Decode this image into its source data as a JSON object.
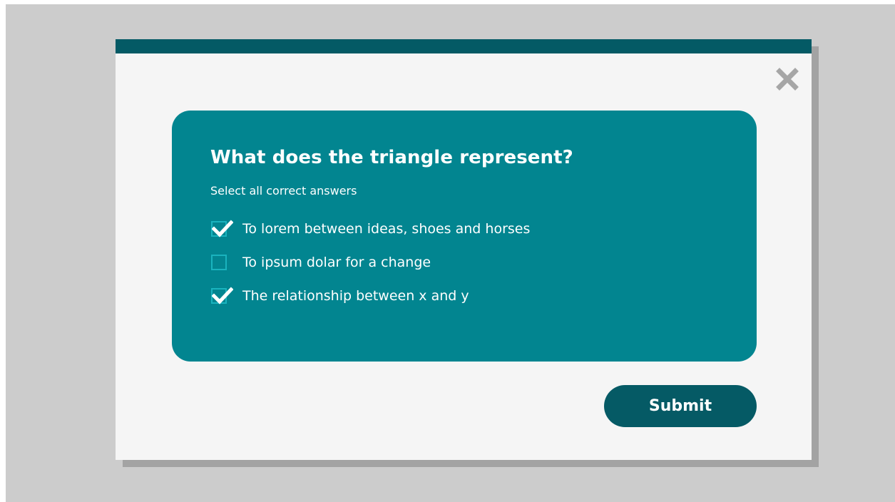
{
  "dialog": {
    "close_icon": "close-icon",
    "question": {
      "title": "What does the triangle represent?",
      "instruction": "Select all correct answers",
      "options": [
        {
          "label": "To lorem between ideas, shoes and horses",
          "checked": true
        },
        {
          "label": "To ipsum dolar for a change",
          "checked": false
        },
        {
          "label": "The relationship between x and y",
          "checked": true
        }
      ]
    },
    "submit_label": "Submit"
  },
  "colors": {
    "backdrop": "#cccccc",
    "modal_background": "#f5f5f5",
    "modal_topbar": "#045a65",
    "card": "#028590",
    "checkbox_border": "#1ab3be",
    "submit_button": "#055a65",
    "close_icon": "#a6a6a6"
  }
}
